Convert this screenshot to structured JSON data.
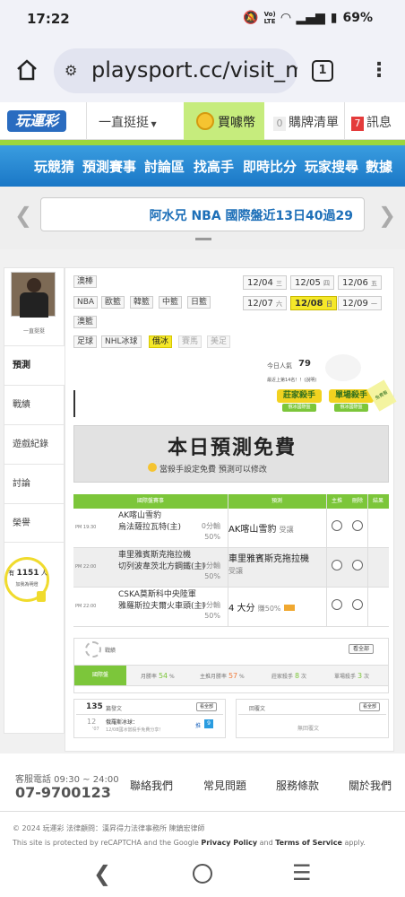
{
  "status": {
    "time": "17:22",
    "battery": "69%"
  },
  "browser": {
    "url": "playsport.cc/visit_m",
    "tab_count": "1"
  },
  "topnav": {
    "logo": "玩運彩",
    "dropdown": "一直挺挺",
    "buy": "買噱幣",
    "cart_count": "0",
    "cart": "購牌清單",
    "msg_count": "7",
    "msg": "訊息"
  },
  "bluenav": [
    "玩競猜",
    "預測賽事",
    "討論區",
    "找高手",
    "即時比分",
    "玩家搜尋",
    "數據"
  ],
  "marquee": {
    "text": "阿水兄 NBA 國際盤近13日40過29"
  },
  "sidebar": {
    "username": "一直挺挺",
    "tabs": [
      "預測",
      "戰績",
      "遊戲紀錄",
      "討論",
      "榮譽"
    ],
    "fans_count": "1151",
    "fans_unit": "人",
    "fans_prefix": "有",
    "fans_sub": "加我為明燈"
  },
  "sports": {
    "row1": [
      "澳棒"
    ],
    "row2": [
      "NBA",
      "歐籃",
      "韓籃",
      "中籃",
      "日籃"
    ],
    "row3": [
      "澳籃"
    ],
    "row4": [
      "足球",
      "NHL冰球",
      "俄冰",
      "賽馬",
      "美足"
    ]
  },
  "dates": [
    {
      "d": "12/04",
      "w": "三"
    },
    {
      "d": "12/05",
      "w": "四"
    },
    {
      "d": "12/06",
      "w": "五"
    },
    {
      "d": "12/07",
      "w": "六"
    },
    {
      "d": "12/08",
      "w": "日"
    },
    {
      "d": "12/09",
      "w": "一"
    }
  ],
  "visitors": {
    "label": "今日人氣",
    "value": "79",
    "rank": "最近上第14名！！(說明)"
  },
  "badges": {
    "b1": "莊家殺手",
    "b1s": "俄冰國際盤",
    "b2": "單場殺手",
    "b2s": "俄冰國際盤",
    "tag": "免費看"
  },
  "free": {
    "title": "本日預測免費",
    "note": "當殺手設定免費  預測可以修改"
  },
  "table": {
    "headers": [
      "國際盤賽事",
      "預測",
      "主推",
      "刪除",
      "結果"
    ],
    "rows": [
      {
        "time": "PM 19:30",
        "home": "AK喀山雪豹",
        "away": "烏法薩拉瓦特(主)",
        "odds1": "0分輸",
        "odds2": "50%",
        "pick": "AK喀山雪豹",
        "pick_note": "受讓"
      },
      {
        "time": "PM 22:00",
        "home": "車里雅賓斯克拖拉機",
        "away": "切列波韋茨北方鋼鐵(主)",
        "odds1": "0分輸",
        "odds2": "50%",
        "pick": "車里雅賓斯克拖拉機",
        "pick_note": "受讓"
      },
      {
        "time": "PM 22:00",
        "home": "CSKA莫斯科中央陸軍",
        "away": "雅羅斯拉夫爾火車頭(主)",
        "odds1": "0分輸",
        "odds2": "50%",
        "pick": "4 大分",
        "pick_note": "賺50%"
      }
    ]
  },
  "stats": {
    "title": "戰績",
    "all_btn": "看全部",
    "tag": "國際盤",
    "month_label": "月勝率",
    "month": "54",
    "main_label": "主推月勝率",
    "main": "57",
    "banker_label": "莊家殺手",
    "banker": "8",
    "single_label": "單場殺手",
    "single": "3",
    "pct": "%",
    "times": "次"
  },
  "posts": {
    "count": "135",
    "label": "篇發文",
    "all_btn": "看全部",
    "item_title": "俄羅斯冰球：",
    "item_sub": "12/08國冰當殺手免費分享！",
    "item_day": "12",
    "item_month": "'07",
    "push": "推",
    "push_count": "9"
  },
  "replies": {
    "label": "回覆文",
    "all_btn": "看全部",
    "empty": "無回覆文"
  },
  "footer": {
    "service": "客服電話 09:30 ~ 24:00",
    "tel": "07-9700123",
    "links": [
      "聯絡我們",
      "常見問題",
      "服務條款",
      "關於我們"
    ],
    "copyright": "© 2024 玩運彩  法律顧問：漢昇得力法律事務所 陳鎮宏律師",
    "recap1": "This site is protected by reCAPTCHA and the Google ",
    "privacy": "Privacy Policy",
    "and": " and ",
    "terms": "Terms of Service",
    "apply": " apply."
  }
}
